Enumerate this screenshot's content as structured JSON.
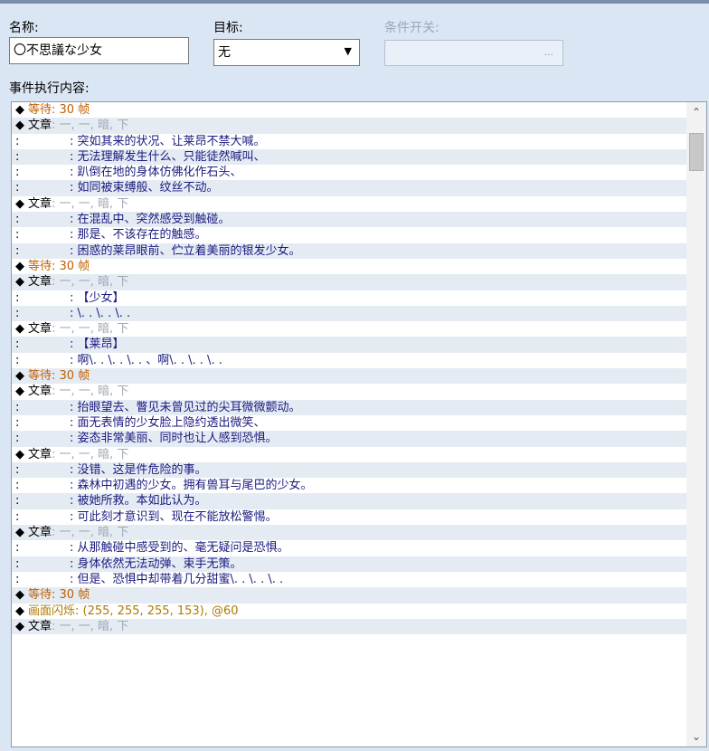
{
  "form": {
    "name_label": "名称:",
    "name_value": "〇不思議な少女",
    "target_label": "目标:",
    "target_value": "无",
    "condition_label": "条件开关:",
    "condition_button": "...",
    "content_label": "事件执行内容:"
  },
  "colors": {
    "wait": "#c06000",
    "flash": "#b07a00",
    "text_body": "#1a1a80",
    "args_gray": "#a0a8b4",
    "row_alt": "#e4ebf3"
  },
  "rows": [
    {
      "kind": "wait",
      "mark": "◆",
      "cmd": "等待",
      "args": ": 30 帧"
    },
    {
      "kind": "cmd",
      "mark": "◆",
      "cmd": "文章",
      "args": ": 一, 一, 暗, 下"
    },
    {
      "kind": "text",
      "lead": ":",
      "body": ": 突如其来的状况、让莱昂不禁大喊。"
    },
    {
      "kind": "text",
      "lead": ":",
      "body": ": 无法理解发生什么、只能徒然喊叫、"
    },
    {
      "kind": "text",
      "lead": ":",
      "body": ": 趴倒在地的身体仿佛化作石头、"
    },
    {
      "kind": "text",
      "lead": ":",
      "body": ": 如同被束缚般、纹丝不动。"
    },
    {
      "kind": "cmd",
      "mark": "◆",
      "cmd": "文章",
      "args": ": 一, 一, 暗, 下"
    },
    {
      "kind": "text",
      "lead": ":",
      "body": ": 在混乱中、突然感受到触碰。"
    },
    {
      "kind": "text",
      "lead": ":",
      "body": ": 那是、不该存在的触感。"
    },
    {
      "kind": "text",
      "lead": ":",
      "body": ": 困惑的莱昂眼前、伫立着美丽的银发少女。"
    },
    {
      "kind": "wait",
      "mark": "◆",
      "cmd": "等待",
      "args": ": 30 帧"
    },
    {
      "kind": "cmd",
      "mark": "◆",
      "cmd": "文章",
      "args": ": 一, 一, 暗, 下"
    },
    {
      "kind": "text",
      "lead": ":",
      "body": ": 【少女】"
    },
    {
      "kind": "text",
      "lead": ":",
      "body": ": \\. . \\. . \\. ."
    },
    {
      "kind": "cmd",
      "mark": "◆",
      "cmd": "文章",
      "args": ": 一, 一, 暗, 下"
    },
    {
      "kind": "text",
      "lead": ":",
      "body": ": 【莱昂】"
    },
    {
      "kind": "text",
      "lead": ":",
      "body": ": 啊\\. . \\. . \\. . 、啊\\. . \\. . \\. ."
    },
    {
      "kind": "wait",
      "mark": "◆",
      "cmd": "等待",
      "args": ": 30 帧"
    },
    {
      "kind": "cmd",
      "mark": "◆",
      "cmd": "文章",
      "args": ": 一, 一, 暗, 下"
    },
    {
      "kind": "text",
      "lead": ":",
      "body": ": 抬眼望去、瞥见未曾见过的尖耳微微颤动。"
    },
    {
      "kind": "text",
      "lead": ":",
      "body": ": 面无表情的少女脸上隐约透出微笑、"
    },
    {
      "kind": "text",
      "lead": ":",
      "body": ": 姿态非常美丽、同时也让人感到恐惧。"
    },
    {
      "kind": "cmd",
      "mark": "◆",
      "cmd": "文章",
      "args": ": 一, 一, 暗, 下"
    },
    {
      "kind": "text",
      "lead": ":",
      "body": ": 没错、这是件危险的事。"
    },
    {
      "kind": "text",
      "lead": ":",
      "body": ": 森林中初遇的少女。拥有兽耳与尾巴的少女。"
    },
    {
      "kind": "text",
      "lead": ":",
      "body": ": 被她所救。本如此认为。"
    },
    {
      "kind": "text",
      "lead": ":",
      "body": ": 可此刻才意识到、现在不能放松警惕。"
    },
    {
      "kind": "cmd",
      "mark": "◆",
      "cmd": "文章",
      "args": ": 一, 一, 暗, 下"
    },
    {
      "kind": "text",
      "lead": ":",
      "body": ": 从那触碰中感受到的、毫无疑问是恐惧。"
    },
    {
      "kind": "text",
      "lead": ":",
      "body": ": 身体依然无法动弹、束手无策。"
    },
    {
      "kind": "text",
      "lead": ":",
      "body": ": 但是、恐惧中却带着几分甜蜜\\. . \\. . \\. ."
    },
    {
      "kind": "wait",
      "mark": "◆",
      "cmd": "等待",
      "args": ": 30 帧"
    },
    {
      "kind": "flash",
      "mark": "◆",
      "cmd": "画面闪烁",
      "args": ": (255, 255, 255, 153), @60"
    },
    {
      "kind": "cmd",
      "mark": "◆",
      "cmd": "文章",
      "args": ": 一, 一, 暗, 下"
    }
  ]
}
